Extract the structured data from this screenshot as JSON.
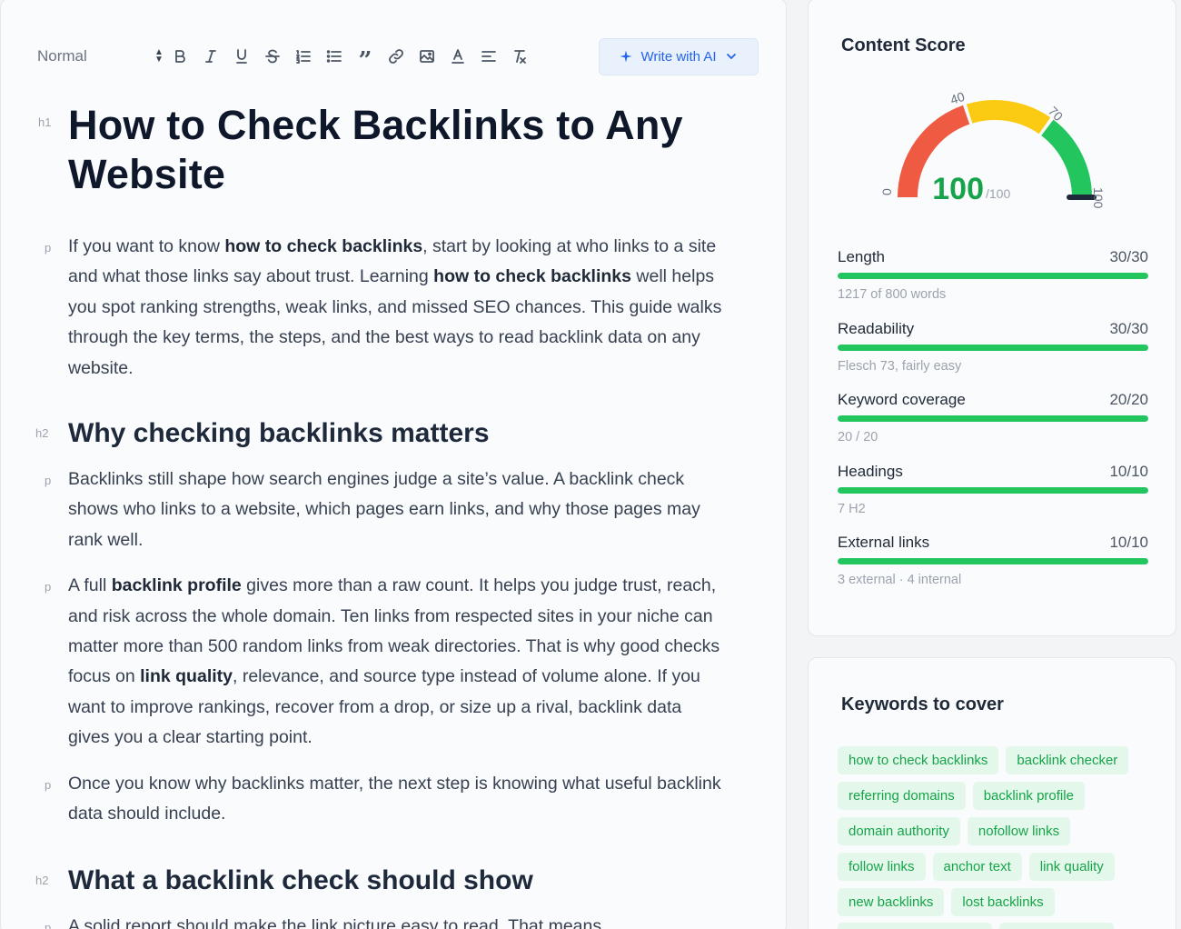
{
  "toolbar": {
    "format_select": "Normal",
    "icons": [
      "bold-icon",
      "italic-icon",
      "underline-icon",
      "strikethrough-icon",
      "ordered-list-icon",
      "bullet-list-icon",
      "blockquote-icon",
      "link-icon",
      "image-icon",
      "text-color-icon",
      "align-icon",
      "clear-format-icon"
    ],
    "ai_button": "Write with AI"
  },
  "doc": {
    "h1_tag": "h1",
    "h2_tag": "h2",
    "p_tag": "p",
    "title": "How to Check Backlinks to Any Website",
    "p1": [
      "If you want to know ",
      "how to check backlinks",
      ", start by looking at who links to a site and what those links say about trust. Learning ",
      "how to check backlinks",
      " well helps you spot ranking strengths, weak links, and missed SEO chances. This guide walks through the key terms, the steps, and the best ways to read backlink data on any website."
    ],
    "h2_1": "Why checking backlinks matters",
    "p2": "Backlinks still shape how search engines judge a site’s value. A backlink check shows who links to a website, which pages earn links, and why those pages may rank well.",
    "p3": [
      "A full ",
      "backlink profile",
      " gives more than a raw count. It helps you judge trust, reach, and risk across the whole domain. Ten links from respected sites in your niche can matter more than 500 random links from weak directories. That is why good checks focus on ",
      "link quality",
      ", relevance, and source type instead of volume alone. If you want to improve rankings, recover from a drop, or size up a rival, backlink data gives you a clear starting point."
    ],
    "p4": "Once you know why backlinks matter, the next step is knowing what useful backlink data should include.",
    "h2_2": "What a backlink check should show",
    "p5": "A solid report should make the link picture easy to read. That means"
  },
  "score": {
    "title": "Content Score",
    "value": "100",
    "max": "/100",
    "gauge_value": 100,
    "gauge_ticks": [
      "0",
      "40",
      "70",
      "100"
    ],
    "gauge_colors": {
      "low": "#ef5a43",
      "mid": "#fbca13",
      "high": "#22c55e",
      "value_text": "#16a34a"
    },
    "metrics": [
      {
        "label": "Length",
        "value": "30/30",
        "fraction": 1.0,
        "sub": "1217 of 800 words"
      },
      {
        "label": "Readability",
        "value": "30/30",
        "fraction": 1.0,
        "sub": "Flesch 73, fairly easy"
      },
      {
        "label": "Keyword coverage",
        "value": "20/20",
        "fraction": 1.0,
        "sub": "20 / 20"
      },
      {
        "label": "Headings",
        "value": "10/10",
        "fraction": 1.0,
        "sub": "7 H2"
      },
      {
        "label": "External links",
        "value": "10/10",
        "fraction": 1.0,
        "sub": "3 external · 4 internal"
      }
    ]
  },
  "keywords": {
    "title": "Keywords to cover",
    "items": [
      "how to check backlinks",
      "backlink checker",
      "referring domains",
      "backlink profile",
      "domain authority",
      "nofollow links",
      "follow links",
      "anchor text",
      "link quality",
      "new backlinks",
      "lost backlinks"
    ]
  }
}
